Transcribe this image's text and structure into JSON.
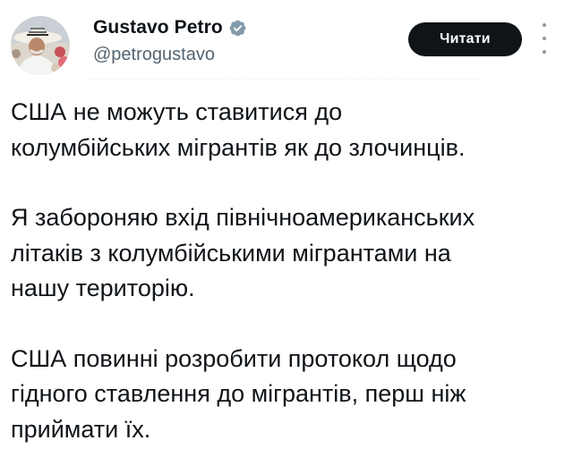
{
  "author": {
    "display_name": "Gustavo Petro",
    "handle": "@petrogustavo",
    "verified_icon": "verified-badge-icon"
  },
  "actions": {
    "follow_label": "Читати",
    "more_icon": "more-options-icon"
  },
  "tweet": {
    "paragraphs": [
      "США не можуть ставитися до\nколумбійських мігрантів як до злочинців.",
      "Я забороняю вхід північноамериканських\nлітаків з колумбійськими мігрантами на\nнашу територію.",
      "США повинні розробити протокол щодо\nгідного ставлення до мігрантів, перш ніж\nприймати їх."
    ]
  },
  "colors": {
    "text": "#0f1419",
    "secondary_text": "#536471",
    "button_bg": "#0f1419",
    "verified_grey": "#829aab"
  }
}
